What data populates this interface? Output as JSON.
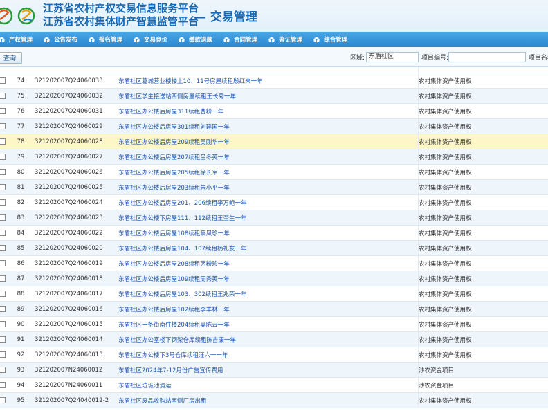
{
  "header": {
    "title_line1": "江苏省农村产权交易信息服务平台",
    "title_line2": "江苏省农村集体财产智慧监管平台",
    "subtitle": "— 交易管理"
  },
  "colors": {
    "title": "#1668b4",
    "nav_bg": "#2a86cf",
    "link": "#1d56b0",
    "highlight_row": "#fdf6c6"
  },
  "nav": {
    "items": [
      {
        "label": "产权管理",
        "icon": "cube-icon"
      },
      {
        "label": "公告发布",
        "icon": "cube-icon"
      },
      {
        "label": "报名管理",
        "icon": "cube-icon"
      },
      {
        "label": "交易竞价",
        "icon": "cube-icon"
      },
      {
        "label": "缴款退款",
        "icon": "cube-icon"
      },
      {
        "label": "合同管理",
        "icon": "cube-icon"
      },
      {
        "label": "鉴证管理",
        "icon": "cube-icon"
      },
      {
        "label": "综合管理",
        "icon": "cube-icon"
      }
    ]
  },
  "toolbar": {
    "search_label": "查询",
    "area_label": "区域:",
    "area_value": "东盾社区",
    "project_no_label": "项目编号:",
    "project_no_value": "",
    "project_name_label": "项目名称"
  },
  "table": {
    "rows": [
      {
        "num": "74",
        "code": "321202007Q24060033",
        "name": "东盾社区葛城营业楼楼上10、11号房屋续租殷红来一年",
        "type": "农村集体资产使用权"
      },
      {
        "num": "75",
        "code": "321202007Q24060032",
        "name": "东盾社区学生接送站西侧房屋续租王长秀一年",
        "type": "农村集体资产使用权"
      },
      {
        "num": "76",
        "code": "321202007Q24060031",
        "name": "东盾社区办公楼后房屋311续租曹粉一年",
        "type": "农村集体资产使用权"
      },
      {
        "num": "77",
        "code": "321202007Q24060029",
        "name": "东盾社区办公楼后房屋301续租刘建国一年",
        "type": "农村集体资产使用权"
      },
      {
        "num": "78",
        "code": "321202007Q24060028",
        "name": "东盾社区办公楼后房屋209续租吴刚华一年",
        "type": "农村集体资产使用权"
      },
      {
        "num": "79",
        "code": "321202007Q24060027",
        "name": "东盾社区办公楼后房屋207续租吕冬英一年",
        "type": "农村集体资产使用权"
      },
      {
        "num": "80",
        "code": "321202007Q24060026",
        "name": "东盾社区办公楼后房屋205续租徐长军一年",
        "type": "农村集体资产使用权"
      },
      {
        "num": "81",
        "code": "321202007Q24060025",
        "name": "东盾社区办公楼后房屋203续租朱小平一年",
        "type": "农村集体资产使用权"
      },
      {
        "num": "82",
        "code": "321202007Q24060024",
        "name": "东盾社区办公楼后房屋201、206续租李万鲍一年",
        "type": "农村集体资产使用权"
      },
      {
        "num": "83",
        "code": "321202007Q24060023",
        "name": "东盾社区办公楼下房屋111、112续租王奎生一年",
        "type": "农村集体资产使用权"
      },
      {
        "num": "84",
        "code": "321202007Q24060022",
        "name": "东盾社区办公楼后房屋108续租蔡凤珍一年",
        "type": "农村集体资产使用权"
      },
      {
        "num": "85",
        "code": "321202007Q24060020",
        "name": "东盾社区办公楼后房屋104、107续租杨礼友一年",
        "type": "农村集体资产使用权"
      },
      {
        "num": "86",
        "code": "321202007Q24060019",
        "name": "东盾社区办公楼后房屋208续租茅粉珍一年",
        "type": "农村集体资产使用权"
      },
      {
        "num": "87",
        "code": "321202007Q24060018",
        "name": "东盾社区办公楼后房屋109续租周秀英一年",
        "type": "农村集体资产使用权"
      },
      {
        "num": "88",
        "code": "321202007Q24060017",
        "name": "东盾社区办公楼后房屋103、302续租王兆荣一年",
        "type": "农村集体资产使用权"
      },
      {
        "num": "89",
        "code": "321202007Q24060016",
        "name": "东盾社区办公楼后房屋102续租李丰林一年",
        "type": "农村集体资产使用权"
      },
      {
        "num": "90",
        "code": "321202007Q24060015",
        "name": "东盾社区一条街南住楼204续租吴陈云一年",
        "type": "农村集体资产使用权"
      },
      {
        "num": "91",
        "code": "321202007Q24060014",
        "name": "东盾社区办公室楼下钢架仓库续租陈吉康一年",
        "type": "农村集体资产使用权"
      },
      {
        "num": "92",
        "code": "321202007Q24060013",
        "name": "东盾社区办公楼下3号仓库续租汪六一一年",
        "type": "农村集体资产使用权"
      },
      {
        "num": "93",
        "code": "321202007N24060012",
        "name": "东盾社区2024年7-12月份广告宣传费用",
        "type": "涉农资金项目"
      },
      {
        "num": "94",
        "code": "321202007N24060011",
        "name": "东盾社区垃圾池清运",
        "type": "涉农资金项目"
      },
      {
        "num": "95",
        "code": "321202007Q24040012-2",
        "name": "东盾社区废品收购站南侧厂房出租",
        "type": "农村集体资产使用权"
      }
    ]
  }
}
